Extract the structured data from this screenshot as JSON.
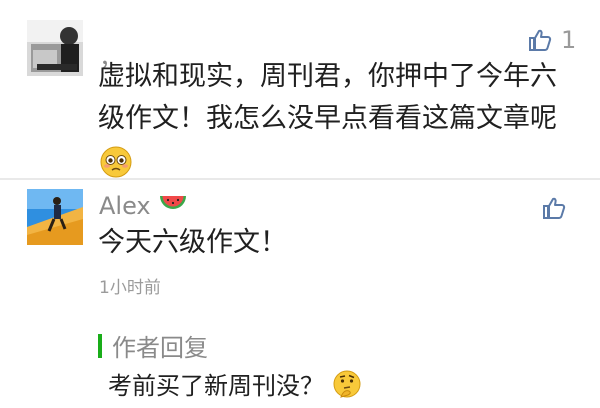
{
  "comments": [
    {
      "name": "，",
      "text_line1": "虚拟和现实，周刊君，你押中了今年六",
      "text_line2": "级作文！我怎么没早点看看这篇文章呢",
      "emoji_icon": "pleading-face-emoji",
      "like_icon": "thumbs-up-icon",
      "like_count": "1"
    },
    {
      "name": "Alex",
      "name_emoji_icon": "watermelon-emoji",
      "text": "今天六级作文！",
      "time": "1小时前",
      "like_icon": "thumbs-up-icon",
      "author_reply": {
        "label": "作者回复",
        "text": "考前买了新周刊没？",
        "emoji_icon": "thinking-face-emoji"
      }
    }
  ],
  "colors": {
    "accent_green": "#19ad19",
    "name_gray": "#8a8a8a",
    "text_dark": "#202020",
    "icon_blue": "#5b7aa8"
  }
}
